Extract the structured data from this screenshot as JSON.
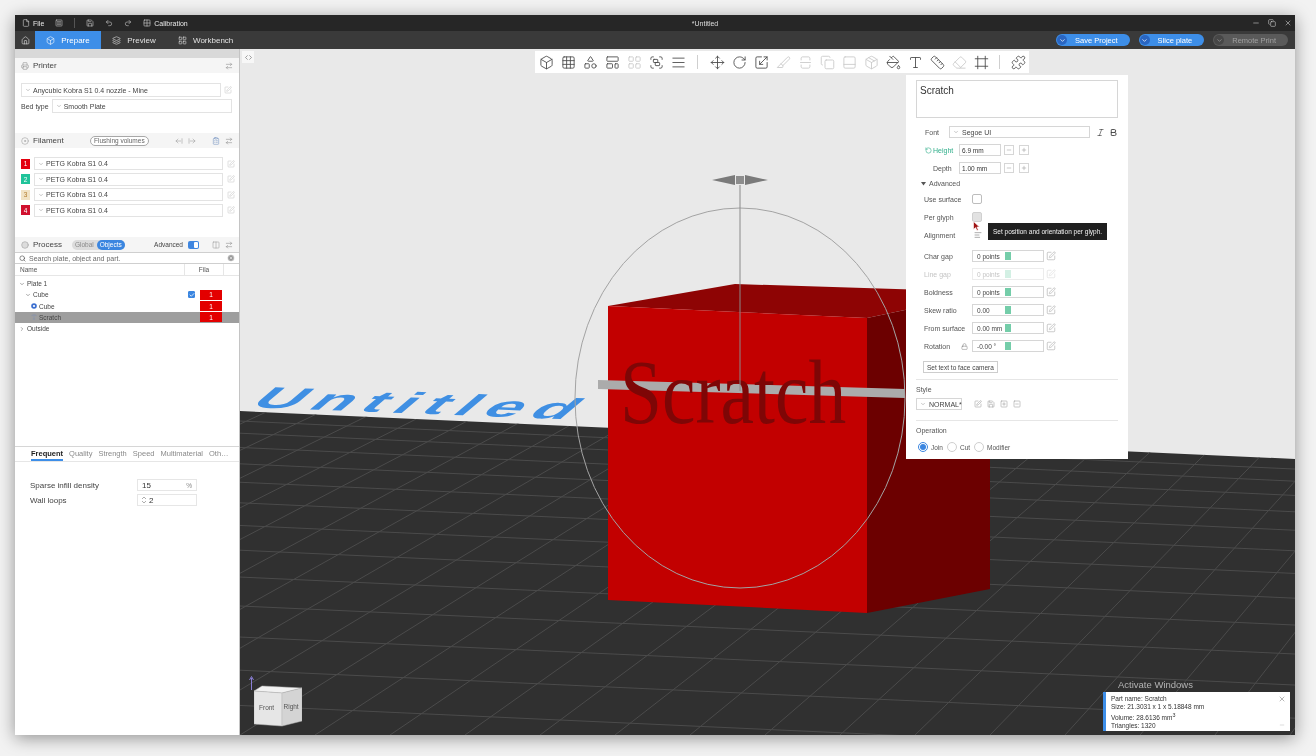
{
  "title_bar": {
    "file_menu": "File",
    "calibration_menu": "Calibration",
    "title": "*Untitled"
  },
  "tabs": [
    {
      "label": "Prepare",
      "selected": true
    },
    {
      "label": "Preview",
      "selected": false
    },
    {
      "label": "Workbench",
      "selected": false
    }
  ],
  "actions": [
    {
      "label": "Save Project",
      "disabled": false
    },
    {
      "label": "Slice plate",
      "disabled": false
    },
    {
      "label": "Remote Print",
      "disabled": true
    }
  ],
  "printer": {
    "title": "Printer",
    "preset": "Anycubic Kobra S1 0.4 nozzle - Mine",
    "bed_type_label": "Bed type",
    "bed_type": "Smooth Plate"
  },
  "filament": {
    "title": "Filament",
    "flushing_button": "Flushing volumes",
    "items": [
      {
        "number": "1",
        "color": "#e3000f",
        "preset": "PETG Kobra S1 0.4"
      },
      {
        "number": "2",
        "color": "#1fc39a",
        "preset": "PETG Kobra S1 0.4"
      },
      {
        "number": "3",
        "color": "#f1e2c4",
        "preset": "PETG Kobra S1 0.4"
      },
      {
        "number": "4",
        "color": "#d0102e",
        "preset": "PETG Kobra S1 0.4"
      }
    ]
  },
  "process": {
    "title": "Process",
    "modes": [
      {
        "label": "Global",
        "selected": false
      },
      {
        "label": "Objects",
        "selected": true
      }
    ],
    "advanced_label": "Advanced",
    "advanced_on": true,
    "search": {
      "placeholder": "Search plate, object and part."
    },
    "columns": [
      "Name",
      "Fila"
    ],
    "tree": [
      {
        "kind": "plate",
        "label": "Plate 1",
        "expanded": true,
        "selected": false,
        "children": [
          {
            "kind": "object",
            "label": "Cube",
            "expanded": true,
            "checked": true,
            "selected": false,
            "filament": "1",
            "children": [
              {
                "kind": "part",
                "label": "Cube",
                "selected": false,
                "filament": "1"
              },
              {
                "kind": "text",
                "label": "Scratch",
                "selected": true,
                "filament": "1"
              }
            ]
          }
        ]
      },
      {
        "kind": "plate",
        "label": "Outside",
        "expanded": false,
        "selected": false
      }
    ]
  },
  "settings": {
    "tabs": [
      {
        "label": "Frequent",
        "selected": true
      },
      {
        "label": "Quality",
        "selected": false
      },
      {
        "label": "Strength",
        "selected": false
      },
      {
        "label": "Speed",
        "selected": false
      },
      {
        "label": "Multimaterial",
        "selected": false
      },
      {
        "label": "Oth…",
        "selected": false
      }
    ],
    "options": [
      {
        "kind": "percent",
        "label": "Sparse infill density",
        "value": "15",
        "unit": "%"
      },
      {
        "kind": "spin",
        "label": "Wall loops",
        "value": "2"
      }
    ]
  },
  "toolbar": {
    "groups": [
      {
        "tools": [
          {
            "disabled": false
          },
          {
            "disabled": false
          },
          {
            "disabled": false
          },
          {
            "disabled": false
          },
          {
            "disabled": true
          },
          {
            "disabled": false
          },
          {
            "disabled": false
          }
        ]
      },
      {
        "tools": [
          {
            "disabled": false
          },
          {
            "disabled": false
          },
          {
            "disabled": false
          },
          {
            "disabled": true
          },
          {
            "disabled": true
          },
          {
            "disabled": true
          },
          {
            "disabled": true
          },
          {
            "disabled": true
          },
          {
            "disabled": false
          },
          {
            "disabled": false
          },
          {
            "disabled": false
          },
          {
            "disabled": true
          },
          {
            "disabled": false
          }
        ]
      },
      {
        "tools": [
          {
            "disabled": false
          }
        ]
      }
    ]
  },
  "viewport": {
    "plate_label": "Untitled",
    "model_text": "Scratch",
    "view_cube": {
      "front": "Front",
      "side": "Right"
    },
    "notice": "Activate Windows"
  },
  "text_panel": {
    "text": "Scratch",
    "font_label": "Font",
    "font": "Segoe UI",
    "size_rows": [
      {
        "label": "Height",
        "value": "6.9 mm",
        "modified": true
      },
      {
        "label": "Depth",
        "value": "1.00 mm",
        "modified": false
      }
    ],
    "advanced": {
      "label": "Advanced",
      "expanded": true
    },
    "checks": [
      {
        "label": "Use surface",
        "checked": false,
        "hovered": false
      },
      {
        "label": "Per glyph",
        "checked": false,
        "hovered": true
      }
    ],
    "alignment_label": "Alignment",
    "tooltip": "Set position and orientation per glyph.",
    "sliders": [
      {
        "kind": "plain",
        "label": "Char gap",
        "value": "0 points",
        "level": 0.5,
        "disabled": false
      },
      {
        "kind": "plain",
        "label": "Line gap",
        "value": "0 points",
        "level": 0.5,
        "disabled": true
      },
      {
        "kind": "plain",
        "label": "Boldness",
        "value": "0 points",
        "level": 0.5,
        "disabled": false
      },
      {
        "kind": "plain",
        "label": "Skew ratio",
        "value": "0.00",
        "level": 0.5,
        "disabled": false
      },
      {
        "kind": "plain",
        "label": "From surface",
        "value": "0.00 mm",
        "level": 0.5,
        "disabled": false
      },
      {
        "kind": "lockable",
        "label": "Rotation",
        "value": "-0.00 °",
        "level": 0.5,
        "disabled": false
      }
    ],
    "face_camera_button": "Set text to face camera",
    "style": {
      "label": "Style",
      "preset": "NORMAL*"
    },
    "operation": {
      "label": "Operation",
      "options": [
        {
          "label": "Join",
          "selected": true
        },
        {
          "label": "Cut",
          "selected": false
        },
        {
          "label": "Modifier",
          "selected": false
        }
      ]
    }
  },
  "part_info": {
    "lines": [
      "Part name: Scratch",
      "Size: 21.3031 x 1 x 5.18848 mm",
      "Volume: 28.6136 mm$^{3}$",
      "Triangles: 1320"
    ]
  }
}
